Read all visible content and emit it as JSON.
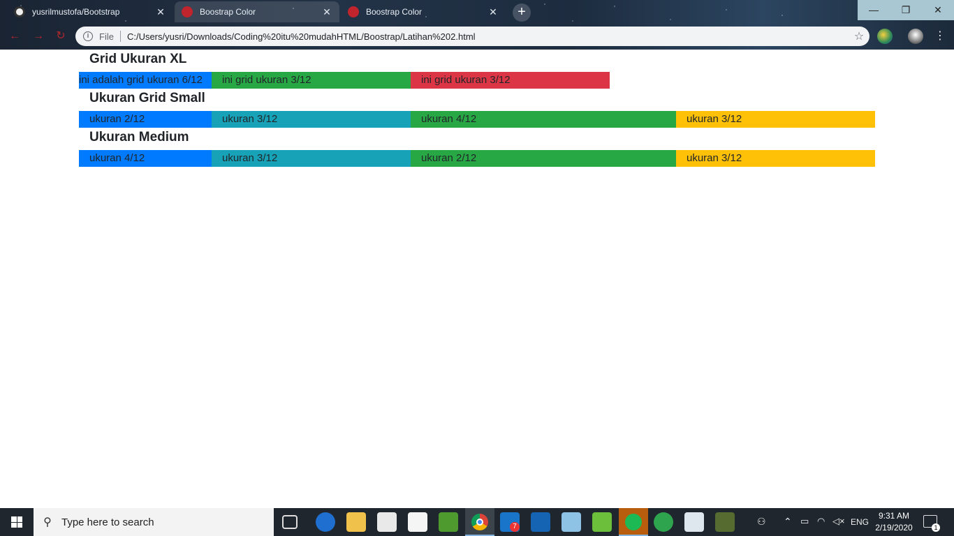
{
  "browser": {
    "tabs": [
      {
        "label": "yusrilmustofa/Bootstrap",
        "favicon": "github-icon"
      },
      {
        "label": "Boostrap Color",
        "favicon": "bootstrap-icon"
      },
      {
        "label": "Boostrap Color",
        "favicon": "bootstrap-icon"
      }
    ],
    "close_glyph": "✕",
    "new_tab_glyph": "+",
    "window_controls": {
      "minimize": "—",
      "maximize": "❐",
      "close": "✕"
    },
    "address_bar": {
      "scheme_label": "File",
      "url": "C:/Users/yusri/Downloads/Coding%20itu%20mudahHTML/Boostrap/Latihan%202.html"
    }
  },
  "page": {
    "sections": [
      {
        "heading": "Grid Ukuran XL",
        "columns": [
          {
            "label": "ini adalah grid ukuran 6/12",
            "color": "#007bff"
          },
          {
            "label": "ini grid ukuran 3/12",
            "color": "#28a745"
          },
          {
            "label": "ini grid ukuran 3/12",
            "color": "#dc3545"
          }
        ]
      },
      {
        "heading": "Ukuran Grid Small",
        "columns": [
          {
            "label": "ukuran 2/12",
            "color": "#007bff"
          },
          {
            "label": "ukuran 3/12",
            "color": "#17a2b8"
          },
          {
            "label": "ukuran 4/12",
            "color": "#28a745"
          },
          {
            "label": "ukuran 3/12",
            "color": "#ffc107"
          }
        ]
      },
      {
        "heading": "Ukuran Medium",
        "columns": [
          {
            "label": "ukuran 4/12",
            "color": "#007bff"
          },
          {
            "label": "ukuran 3/12",
            "color": "#17a2b8"
          },
          {
            "label": "ukuran 2/12",
            "color": "#28a745"
          },
          {
            "label": "ukuran 3/12",
            "color": "#ffc107"
          }
        ]
      }
    ]
  },
  "taskbar": {
    "search_placeholder": "Type here to search",
    "mail_badge": "7",
    "language": "ENG",
    "time": "9:31 AM",
    "date": "2/19/2020",
    "notification_count": "1"
  }
}
